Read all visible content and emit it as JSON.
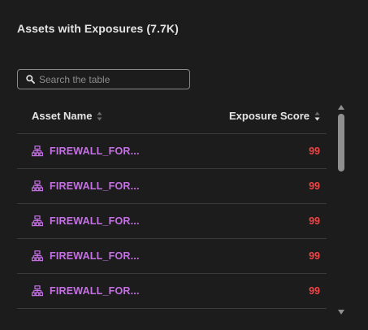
{
  "panel": {
    "title": "Assets with Exposures (7.7K)"
  },
  "search": {
    "placeholder": "Search the table",
    "value": ""
  },
  "table": {
    "columns": {
      "asset_name": "Asset Name",
      "exposure_score": "Exposure Score"
    },
    "rows": [
      {
        "asset": "FIREWALL_FOR...",
        "score": "99",
        "icon": "network-tree-icon"
      },
      {
        "asset": "FIREWALL_FOR...",
        "score": "99",
        "icon": "network-tree-icon"
      },
      {
        "asset": "FIREWALL_FOR...",
        "score": "99",
        "icon": "network-tree-icon"
      },
      {
        "asset": "FIREWALL_FOR...",
        "score": "99",
        "icon": "network-tree-icon"
      },
      {
        "asset": "FIREWALL_FOR...",
        "score": "99",
        "icon": "network-tree-icon"
      }
    ]
  },
  "colors": {
    "background": "#1c1c1c",
    "asset_link": "#c670e6",
    "score_critical": "#f04545",
    "divider": "#3a3a3a"
  }
}
